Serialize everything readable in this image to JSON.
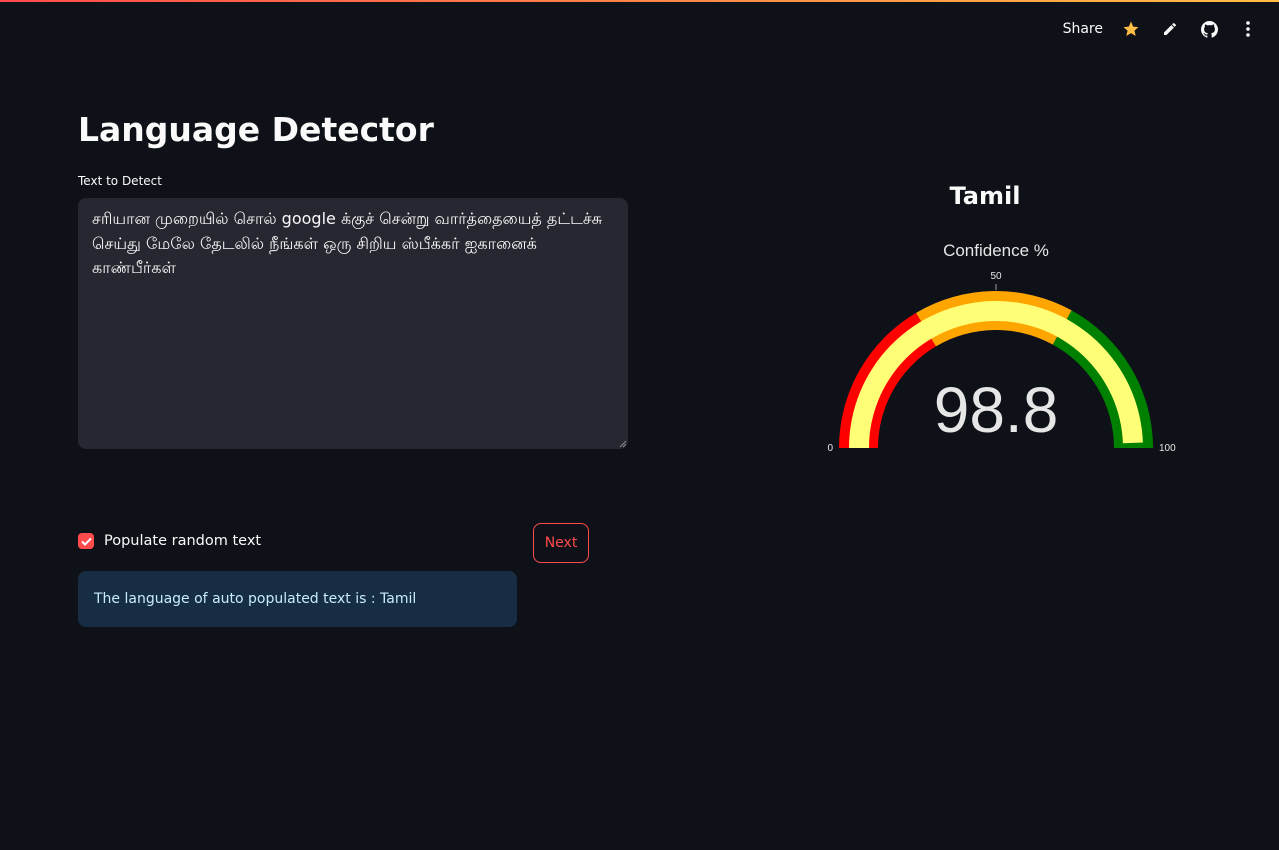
{
  "toolbar": {
    "share_label": "Share",
    "icons": [
      "star-icon",
      "edit-icon",
      "github-icon",
      "more-vertical-icon"
    ]
  },
  "page": {
    "title": "Language Detector"
  },
  "input": {
    "label": "Text to Detect",
    "value": "சரியான முறையில் சொல் google க்குச் சென்று வார்த்தையைத் தட்டச்சு செய்து மேலே தேடலில் நீங்கள் ஒரு சிறிய ஸ்பீக்கர் ஐகானைக் காண்பீர்கள்"
  },
  "controls": {
    "checkbox_label": "Populate random text",
    "checkbox_checked": true,
    "next_label": "Next"
  },
  "info": {
    "message": "The language of auto populated text is : Tamil"
  },
  "result": {
    "language": "Tamil",
    "gauge": {
      "title": "Confidence %",
      "value": 98.8,
      "value_text": "98.8",
      "min": 0,
      "max": 100,
      "min_label": "0",
      "mid_label": "50",
      "max_label": "100",
      "steps": [
        {
          "from": 0,
          "to": 33,
          "color": "#ff0000"
        },
        {
          "from": 33,
          "to": 66,
          "color": "#ffa500"
        },
        {
          "from": 66,
          "to": 100,
          "color": "#008000"
        }
      ],
      "bar_color": "#ffff77"
    }
  },
  "colors": {
    "background": "#0e1117",
    "accent": "#ff4b4b",
    "info_bg": "#172d43",
    "info_text": "#c7ebff",
    "star": "#ffbd45"
  }
}
